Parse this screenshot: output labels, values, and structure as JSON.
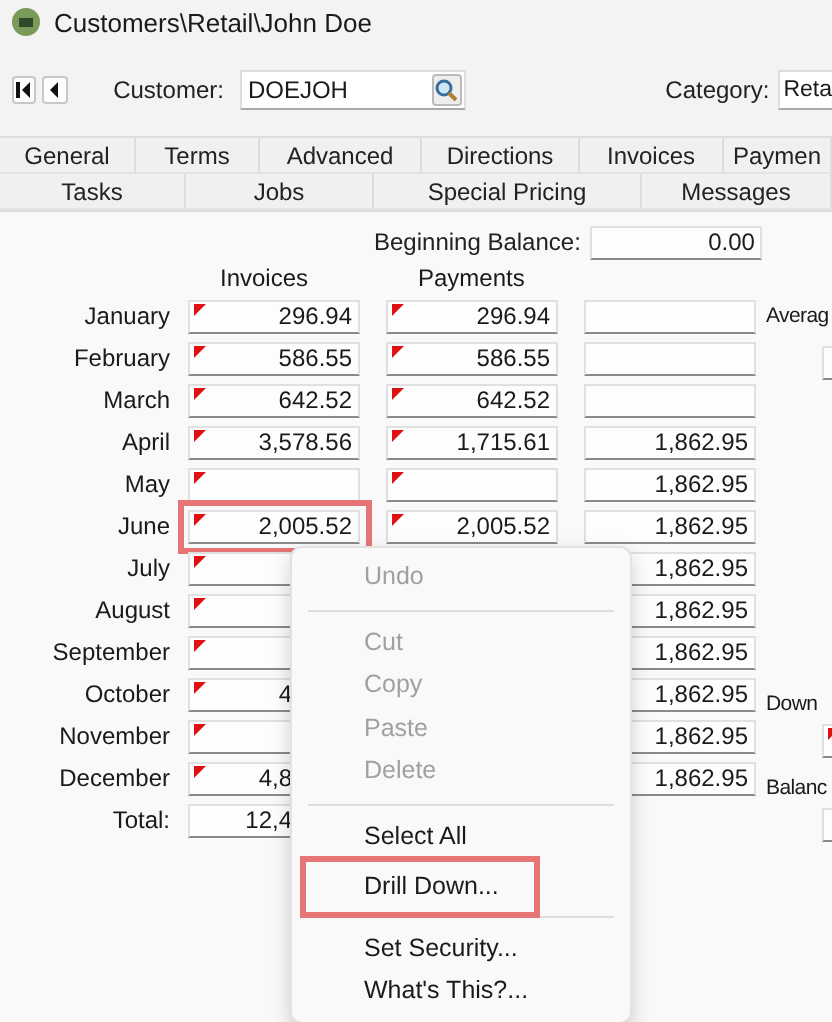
{
  "window": {
    "title": "Customers\\Retail\\John Doe"
  },
  "toolbar": {
    "customer_label": "Customer:",
    "customer_value": "DOEJOH",
    "category_label": "Category:",
    "category_value": "Reta"
  },
  "tabs": [
    [
      {
        "label": "General",
        "selected": false
      },
      {
        "label": "Terms",
        "selected": false
      },
      {
        "label": "Advanced",
        "selected": false
      },
      {
        "label": "Directions",
        "selected": false
      },
      {
        "label": "Invoices",
        "selected": false
      },
      {
        "label": "Paymen",
        "selected": false
      }
    ],
    [
      {
        "label": "Tasks",
        "selected": false
      },
      {
        "label": "Jobs",
        "selected": false
      },
      {
        "label": "Special Pricing",
        "selected": false
      },
      {
        "label": "Messages",
        "selected": false
      }
    ]
  ],
  "beginning_balance": {
    "label": "Beginning Balance:",
    "value": "0.00"
  },
  "columns": [
    "Invoices",
    "Payments"
  ],
  "rows": [
    {
      "month": "January",
      "invoices": "296.94",
      "payments": "296.94",
      "balance": "",
      "highlighted": false
    },
    {
      "month": "February",
      "invoices": "586.55",
      "payments": "586.55",
      "balance": "",
      "highlighted": false
    },
    {
      "month": "March",
      "invoices": "642.52",
      "payments": "642.52",
      "balance": "",
      "highlighted": false
    },
    {
      "month": "April",
      "invoices": "3,578.56",
      "payments": "1,715.61",
      "balance": "1,862.95",
      "highlighted": false
    },
    {
      "month": "May",
      "invoices": "",
      "payments": "",
      "balance": "1,862.95",
      "highlighted": false
    },
    {
      "month": "June",
      "invoices": "2,005.52",
      "payments": "2,005.52",
      "balance": "1,862.95",
      "highlighted": true
    },
    {
      "month": "July",
      "invoices": "",
      "balance": "1,862.95",
      "highlighted": false
    },
    {
      "month": "August",
      "invoices": "",
      "balance": "1,862.95",
      "highlighted": false
    },
    {
      "month": "September",
      "invoices": "",
      "balance": "1,862.95",
      "highlighted": false
    },
    {
      "month": "October",
      "invoices": "4",
      "balance": "1,862.95",
      "highlighted": false
    },
    {
      "month": "November",
      "invoices": "",
      "balance": "1,862.95",
      "highlighted": false
    },
    {
      "month": "December",
      "invoices": "4,8",
      "balance": "1,862.95",
      "highlighted": false
    }
  ],
  "total": {
    "label": "Total:",
    "invoices": "12,4"
  },
  "side": {
    "average_label": "Averag",
    "down_label": "Down",
    "balance_label": "Balanc"
  },
  "context_menu": [
    {
      "kind": "item",
      "label": "Undo",
      "disabled": true,
      "highlighted": false
    },
    {
      "kind": "separator"
    },
    {
      "kind": "item",
      "label": "Cut",
      "disabled": true,
      "highlighted": false
    },
    {
      "kind": "item",
      "label": "Copy",
      "disabled": true,
      "highlighted": false
    },
    {
      "kind": "item",
      "label": "Paste",
      "disabled": true,
      "highlighted": false
    },
    {
      "kind": "item",
      "label": "Delete",
      "disabled": true,
      "highlighted": false
    },
    {
      "kind": "separator"
    },
    {
      "kind": "item",
      "label": "Select All",
      "disabled": false,
      "highlighted": false
    },
    {
      "kind": "item",
      "label": "Drill Down...",
      "disabled": false,
      "highlighted": true
    },
    {
      "kind": "separator"
    },
    {
      "kind": "item",
      "label": "Set Security...",
      "disabled": false,
      "highlighted": false
    },
    {
      "kind": "item",
      "label": "What's This?...",
      "disabled": false,
      "highlighted": false
    }
  ]
}
